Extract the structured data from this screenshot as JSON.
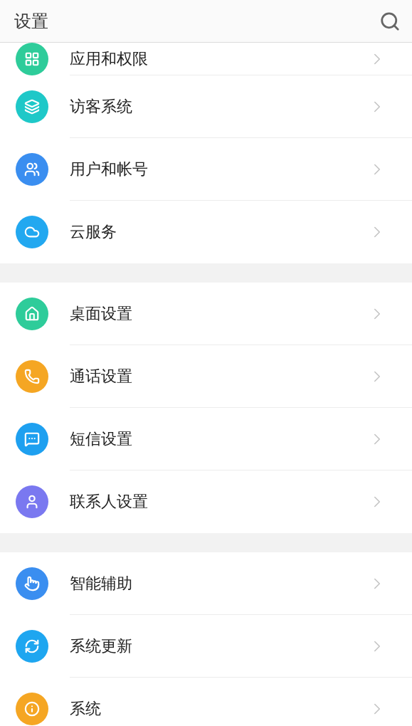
{
  "header": {
    "title": "设置"
  },
  "groups": [
    {
      "items": [
        {
          "label": "应用和权限",
          "color": "#2ecc9a"
        },
        {
          "label": "访客系统",
          "color": "#1ec8c8"
        },
        {
          "label": "用户和帐号",
          "color": "#3a8ef0"
        },
        {
          "label": "云服务",
          "color": "#22a8f0"
        }
      ]
    },
    {
      "items": [
        {
          "label": "桌面设置",
          "color": "#2ecc9a"
        },
        {
          "label": "通话设置",
          "color": "#f5a623"
        },
        {
          "label": "短信设置",
          "color": "#1ea0f0"
        },
        {
          "label": "联系人设置",
          "color": "#7a78f0"
        }
      ]
    },
    {
      "items": [
        {
          "label": "智能辅助",
          "color": "#3a8ef0"
        },
        {
          "label": "系统更新",
          "color": "#1ea6f0"
        },
        {
          "label": "系统",
          "color": "#f5a623"
        }
      ]
    }
  ]
}
